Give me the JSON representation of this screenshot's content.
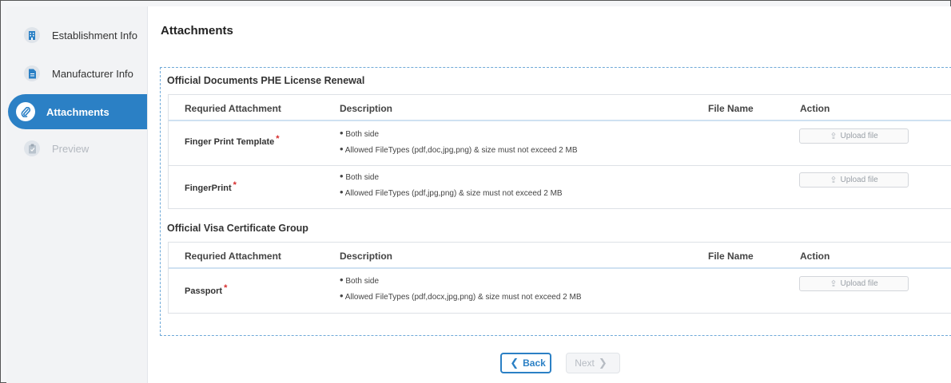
{
  "sidebar": {
    "items": [
      {
        "label": "Establishment Info",
        "icon": "building-icon",
        "state": "normal"
      },
      {
        "label": "Manufacturer Info",
        "icon": "document-icon",
        "state": "normal"
      },
      {
        "label": "Attachments",
        "icon": "paperclip-icon",
        "state": "active"
      },
      {
        "label": "Preview",
        "icon": "clipboard-icon",
        "state": "disabled"
      }
    ]
  },
  "main": {
    "title": "Attachments",
    "groups": [
      {
        "title": "Official Documents PHE  License Renewal",
        "headers": {
          "required": "Requried Attachment",
          "description": "Description",
          "file_name": "File Name",
          "action": "Action"
        },
        "rows": [
          {
            "name": "Finger Print Template",
            "required_mark": "*",
            "desc1": "Both side",
            "desc2": "Allowed FileTypes (pdf,doc,jpg,png) & size must not exceed 2 MB",
            "upload": "Upload file"
          },
          {
            "name": "FingerPrint",
            "required_mark": "*",
            "desc1": "Both side",
            "desc2": "Allowed FileTypes (pdf,jpg,png) & size must not exceed 2 MB",
            "upload": "Upload file"
          }
        ]
      },
      {
        "title": "Official Visa Certificate Group",
        "headers": {
          "required": "Requried Attachment",
          "description": "Description",
          "file_name": "File Name",
          "action": "Action"
        },
        "rows": [
          {
            "name": "Passport",
            "required_mark": "*",
            "desc1": "Both side",
            "desc2": "Allowed FileTypes (pdf,docx,jpg,png) & size must not exceed 2 MB",
            "upload": "Upload file"
          }
        ]
      }
    ]
  },
  "footer": {
    "back_label": "Back",
    "next_label": "Next"
  },
  "colors": {
    "accent": "#2b80c5",
    "required": "#d62b2b",
    "border": "#dde1e6"
  }
}
